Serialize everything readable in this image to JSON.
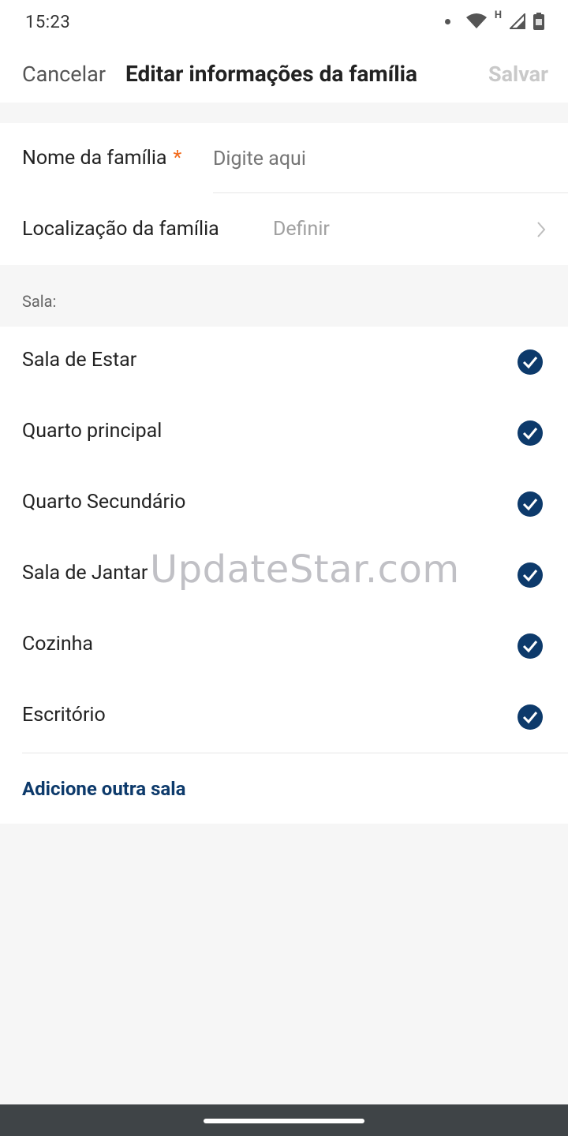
{
  "status_bar": {
    "time": "15:23",
    "network_label": "H"
  },
  "nav": {
    "cancel_label": "Cancelar",
    "title": "Editar informações da família",
    "save_label": "Salvar"
  },
  "form": {
    "family_name_label": "Nome da família",
    "required_mark": "*",
    "family_name_placeholder": "Digite aqui",
    "family_name_value": "",
    "location_label": "Localização da família",
    "location_value": "Definir"
  },
  "rooms": {
    "section_label": "Sala:",
    "items": [
      {
        "label": "Sala de Estar",
        "checked": true
      },
      {
        "label": "Quarto principal",
        "checked": true
      },
      {
        "label": "Quarto Secundário",
        "checked": true
      },
      {
        "label": "Sala de Jantar",
        "checked": true
      },
      {
        "label": "Cozinha",
        "checked": true
      },
      {
        "label": "Escritório",
        "checked": true
      }
    ],
    "add_label": "Adicione outra sala"
  },
  "watermark": "UpdateStar.com",
  "colors": {
    "accent": "#0d3a6b",
    "required": "#f26a1b",
    "disabled": "#c9c9c9"
  }
}
